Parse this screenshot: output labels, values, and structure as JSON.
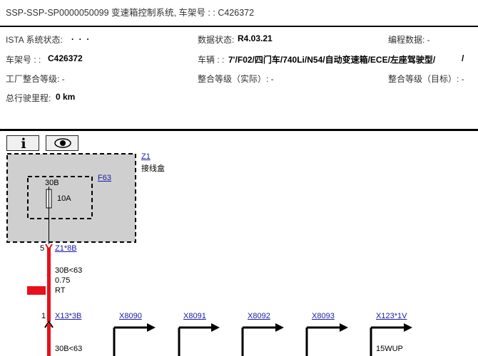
{
  "header": {
    "title": "SSP-SSP-SP0000050099 变速箱控制系统, 车架号 : : C426372"
  },
  "info": {
    "ista_label": "ISTA 系统状态:",
    "ista_value": ". . .",
    "data_label": "数据状态:",
    "data_value": "R4.03.21",
    "prog_label": "编程数据: -",
    "vin_label": "车架号 : :",
    "vin_value": "C426372",
    "vehicle_label": "车辆 : :",
    "vehicle_value": "7'/F02/四门车/740Li/N54/自动变速箱/ECE/左座驾驶型/",
    "vehicle_slash": "/",
    "factory_level": "工厂整合等级: -",
    "actual_level": "整合等级（实际）: -",
    "target_level": "整合等级（目标）: -",
    "mileage_label": "总行驶里程:",
    "mileage_value": "0 km"
  },
  "toolbar": {
    "info_icon": "info-icon",
    "view_icon": "eye-icon"
  },
  "diagram": {
    "z1_link": "Z1",
    "z1_name": "接线盒",
    "f63_link": "F63",
    "fuse_pin": "30B",
    "fuse_rating": "10A",
    "pin_5": "5",
    "z1_8b_link": "Z1*8B",
    "wire1_signal": "30B<63",
    "wire1_gauge": "0.75",
    "wire1_color": "RT",
    "pin_1": "1",
    "x13_3b_link": "X13*3B",
    "x8090_link": "X8090",
    "x8091_link": "X8091",
    "x8092_link": "X8092",
    "x8093_link": "X8093",
    "x123_1v_link": "X123*1V",
    "wire2_signal": "30B<63",
    "wire3_signal": "15WUP",
    "wire_color_hex": "#e8101a",
    "box_fill_hex": "#cfcfcf"
  }
}
